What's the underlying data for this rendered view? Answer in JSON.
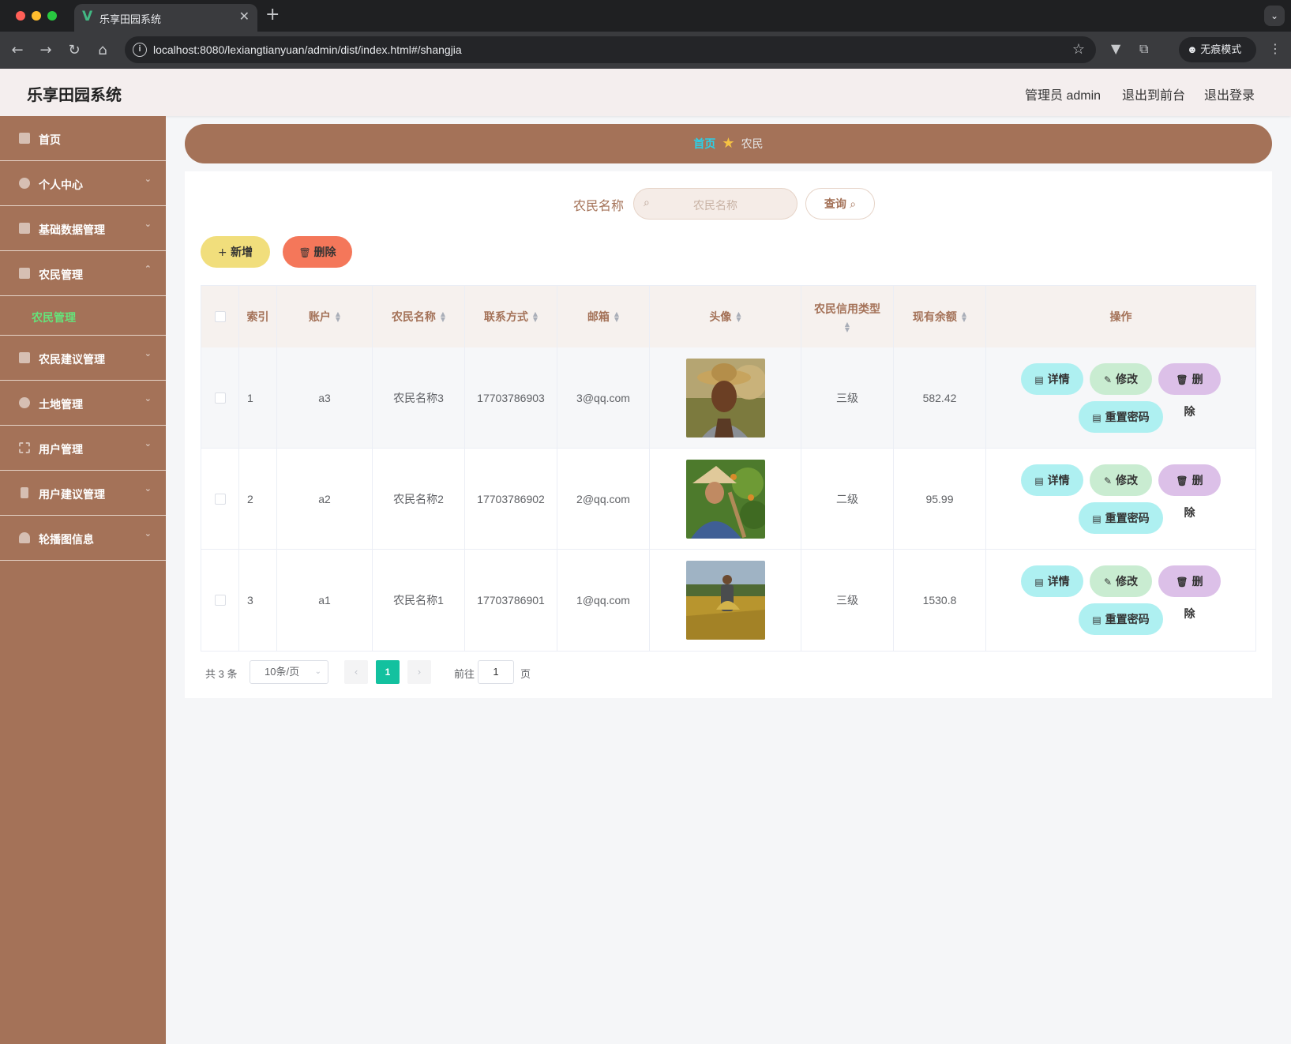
{
  "browser": {
    "tab_title": "乐享田园系统",
    "url": "localhost:8080/lexiangtianyuan/admin/dist/index.html#/shangjia",
    "incognito_label": "无痕模式"
  },
  "header": {
    "app_title": "乐享田园系统",
    "admin_label": "管理员 admin",
    "to_front_label": "退出到前台",
    "logout_label": "退出登录"
  },
  "sidebar": {
    "items": [
      {
        "label": "首页",
        "icon": "home-icon",
        "expandable": false
      },
      {
        "label": "个人中心",
        "icon": "user-icon",
        "expandable": true
      },
      {
        "label": "基础数据管理",
        "icon": "chart-icon",
        "expandable": true
      },
      {
        "label": "农民管理",
        "icon": "table-icon",
        "expandable": true,
        "open": true
      },
      {
        "label": "农民建议管理",
        "icon": "bar-chart-icon",
        "expandable": true
      },
      {
        "label": "土地管理",
        "icon": "compass-icon",
        "expandable": true
      },
      {
        "label": "用户管理",
        "icon": "frame-icon",
        "expandable": true
      },
      {
        "label": "用户建议管理",
        "icon": "mic-icon",
        "expandable": true
      },
      {
        "label": "轮播图信息",
        "icon": "user-icon",
        "expandable": true
      }
    ],
    "submenu": {
      "label": "农民管理"
    }
  },
  "breadcrumb": {
    "home": "首页",
    "current": "农民"
  },
  "search": {
    "label": "农民名称",
    "placeholder": "农民名称",
    "query_label": "查询"
  },
  "toolbar": {
    "add_label": "新增",
    "delete_label": "删除"
  },
  "table": {
    "headers": [
      "索引",
      "账户",
      "农民名称",
      "联系方式",
      "邮箱",
      "头像",
      "农民信用类型",
      "现有余额",
      "操作"
    ],
    "rows": [
      {
        "index": "1",
        "account": "a3",
        "name": "农民名称3",
        "phone": "17703786903",
        "email": "3@qq.com",
        "credit": "三级",
        "balance": "582.42"
      },
      {
        "index": "2",
        "account": "a2",
        "name": "农民名称2",
        "phone": "17703786902",
        "email": "2@qq.com",
        "credit": "二级",
        "balance": "95.99"
      },
      {
        "index": "3",
        "account": "a1",
        "name": "农民名称1",
        "phone": "17703786901",
        "email": "1@qq.com",
        "credit": "三级",
        "balance": "1530.8"
      }
    ],
    "actions": {
      "detail": "详情",
      "edit": "修改",
      "delete": "删除",
      "reset": "重置密码"
    }
  },
  "pagination": {
    "total": "共 3 条",
    "page_size": "10条/页",
    "current_page": "1",
    "goto_prefix": "前往",
    "goto_value": "1",
    "goto_suffix": "页"
  },
  "colors": {
    "brand": "#a47258",
    "active_submenu": "#66e27a",
    "breadcrumb_home": "#2ad1e9",
    "pagination_active": "#13c19f"
  }
}
